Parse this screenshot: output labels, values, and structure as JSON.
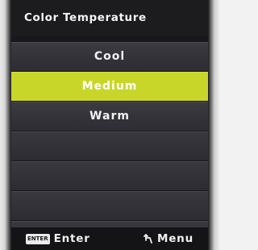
{
  "osd": {
    "title": "Color Temperature",
    "options": [
      {
        "label": "Cool",
        "selected": false
      },
      {
        "label": "Medium",
        "selected": true
      },
      {
        "label": "Warm",
        "selected": false
      }
    ],
    "empty_rows": 4,
    "footer": {
      "enter_badge": "ENTER",
      "enter_label": "Enter",
      "menu_label": "Menu",
      "menu_icon": "return-arrow-icon"
    }
  },
  "colors": {
    "highlight": "#c8d62a",
    "background": "#18181a",
    "row": "#36353b",
    "text": "#ffffff"
  }
}
